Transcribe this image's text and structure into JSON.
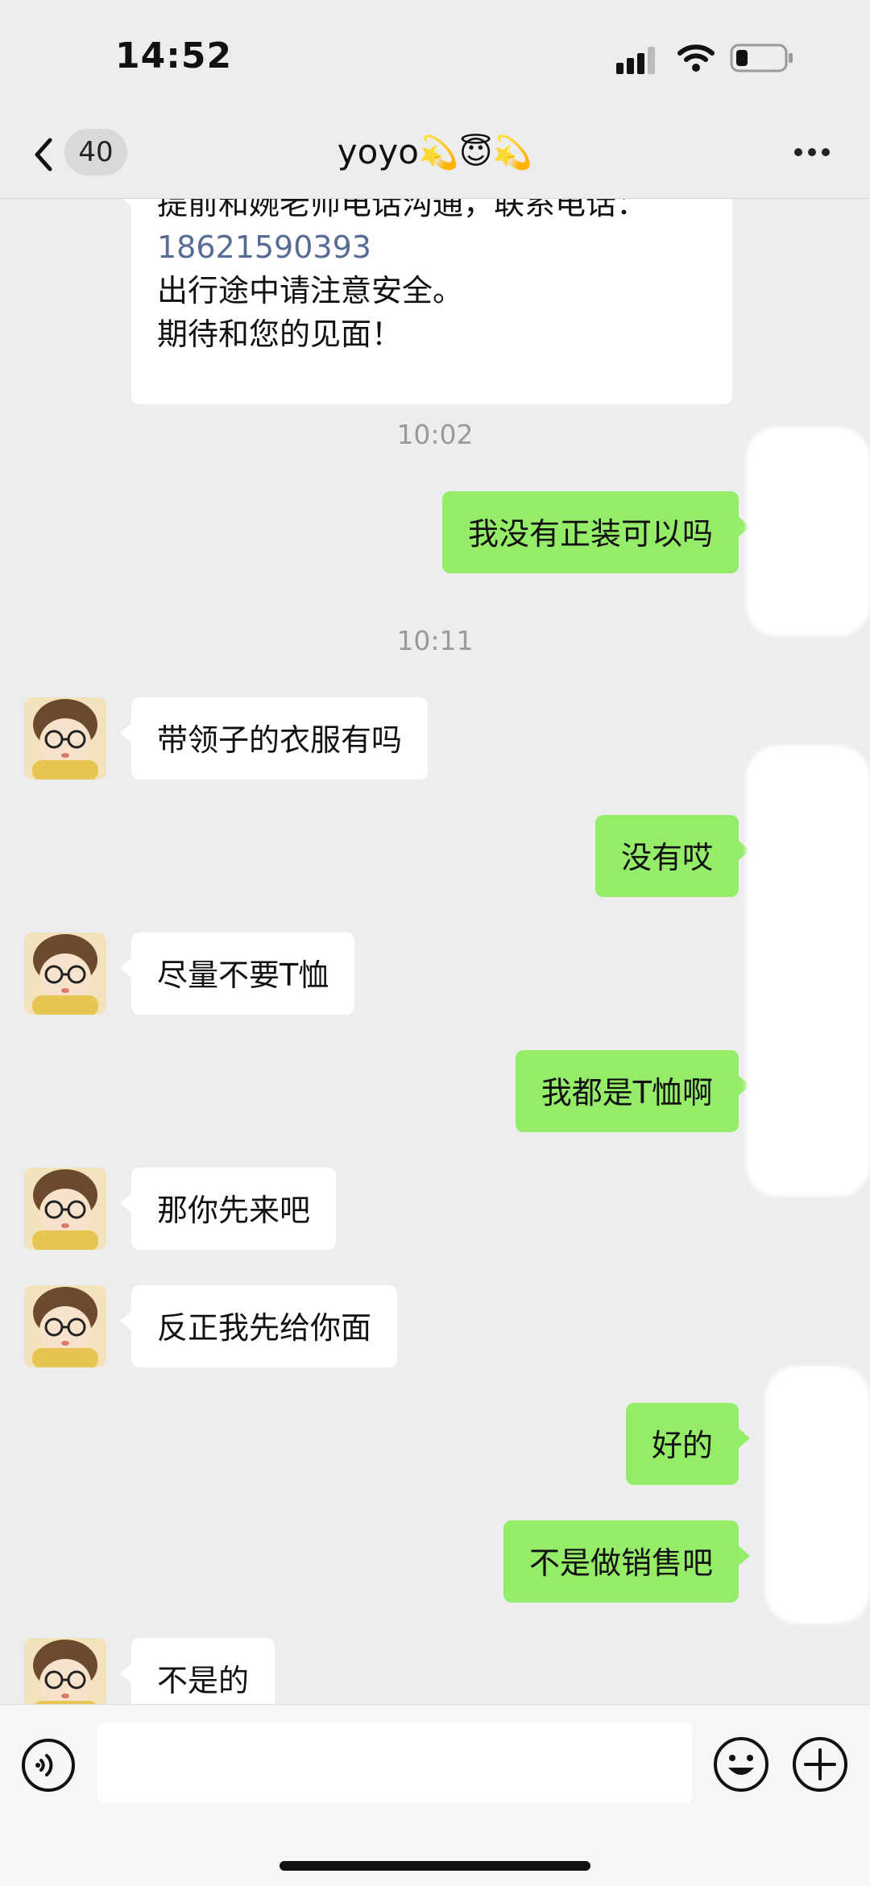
{
  "status_bar": {
    "time": "14:52"
  },
  "nav": {
    "unread_badge": "40",
    "contact_name": "yoyo",
    "title_emojis": "💫😇💫"
  },
  "chat": {
    "top_message": {
      "line1": "提前和婉老师电话沟通，联系电话：",
      "phone": "18621590393",
      "line2": "出行途中请注意安全。",
      "line3": "期待和您的见面！"
    },
    "timestamps": [
      "10:02",
      "10:11"
    ],
    "messages": [
      {
        "side": "out",
        "text": "我没有正装可以吗"
      },
      {
        "side": "in",
        "text": "带领子的衣服有吗"
      },
      {
        "side": "out",
        "text": "没有哎"
      },
      {
        "side": "in",
        "text": "尽量不要T恤"
      },
      {
        "side": "out",
        "text": "我都是T恤啊"
      },
      {
        "side": "in",
        "text": "那你先来吧"
      },
      {
        "side": "in",
        "text": "反正我先给你面"
      },
      {
        "side": "out",
        "text": "好的"
      },
      {
        "side": "out",
        "text": "不是做销售吧"
      },
      {
        "side": "in",
        "text": "不是的"
      }
    ]
  },
  "input_bar": {
    "text_value": ""
  },
  "colors": {
    "background": "#ededed",
    "outgoing_bubble": "#95ec69",
    "incoming_bubble": "#ffffff",
    "link": "#576b95"
  },
  "icons": [
    "back-arrow-icon",
    "more-icon",
    "voice-icon",
    "emoji-icon",
    "plus-icon",
    "signal-icon",
    "wifi-icon",
    "battery-icon"
  ]
}
